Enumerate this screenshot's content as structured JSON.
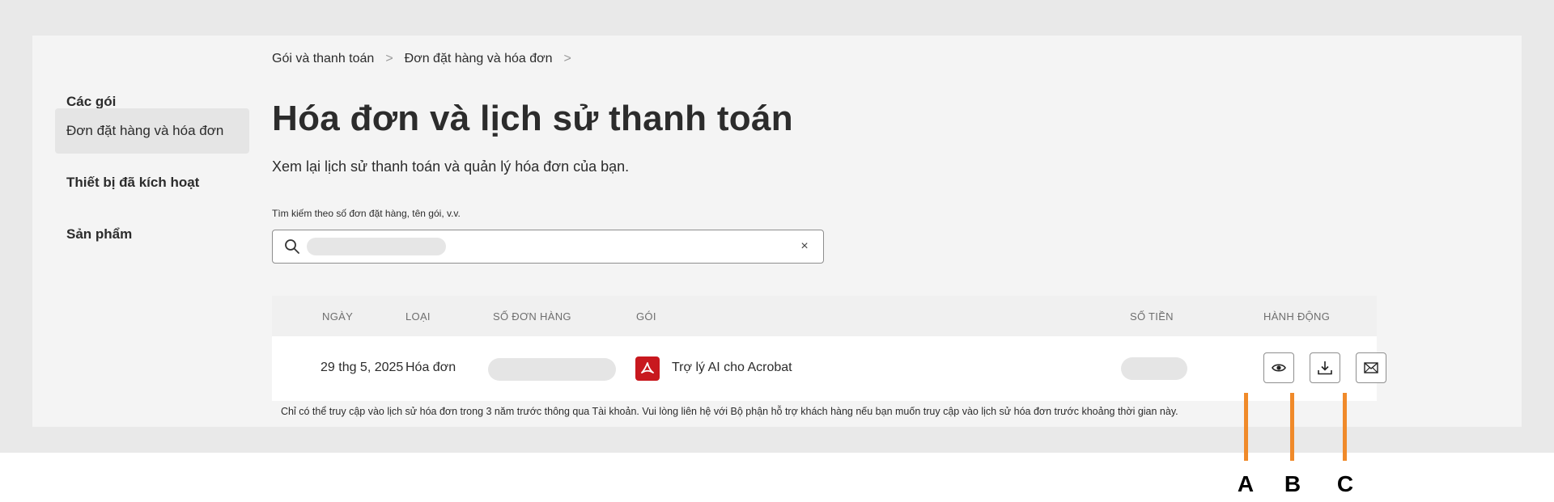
{
  "sidebar": {
    "items": [
      {
        "label": "Các gói"
      },
      {
        "label": "Đơn đặt hàng và hóa đơn"
      },
      {
        "label": "Thiết bị đã kích hoạt"
      },
      {
        "label": "Sản phẩm"
      }
    ]
  },
  "breadcrumb": {
    "items": [
      "Gói và thanh toán",
      "Đơn đặt hàng và hóa đơn"
    ],
    "separator": ">"
  },
  "page": {
    "title": "Hóa đơn và lịch sử thanh toán",
    "subtitle": "Xem lại lịch sử thanh toán và quản lý hóa đơn của bạn."
  },
  "search": {
    "label": "Tìm kiếm theo số đơn đặt hàng, tên gói, v.v.",
    "clear_symbol": "×"
  },
  "table": {
    "headers": {
      "date": "NGÀY",
      "type": "LOẠI",
      "order_number": "SỐ ĐƠN HÀNG",
      "plan": "GÓI",
      "amount": "SỐ TIỀN",
      "actions": "HÀNH ĐỘNG"
    },
    "rows": [
      {
        "date": "29 thg 5, 2025",
        "type": "Hóa đơn",
        "plan": "Trợ lý AI cho Acrobat"
      }
    ]
  },
  "note": "Chỉ có thể truy cập vào lịch sử hóa đơn trong 3 năm trước thông qua Tài khoản. Vui lòng liên hệ với Bộ phận hỗ trợ khách hàng nếu bạn muốn truy cập vào lịch sử hóa đơn trước khoảng thời gian này.",
  "callouts": [
    "A",
    "B",
    "C"
  ],
  "colors": {
    "accent_callout": "#f08a2a",
    "pdf_brand": "#c8181e"
  },
  "icons": [
    "search-icon",
    "eye-icon",
    "download-icon",
    "mail-icon",
    "pdf-icon"
  ]
}
